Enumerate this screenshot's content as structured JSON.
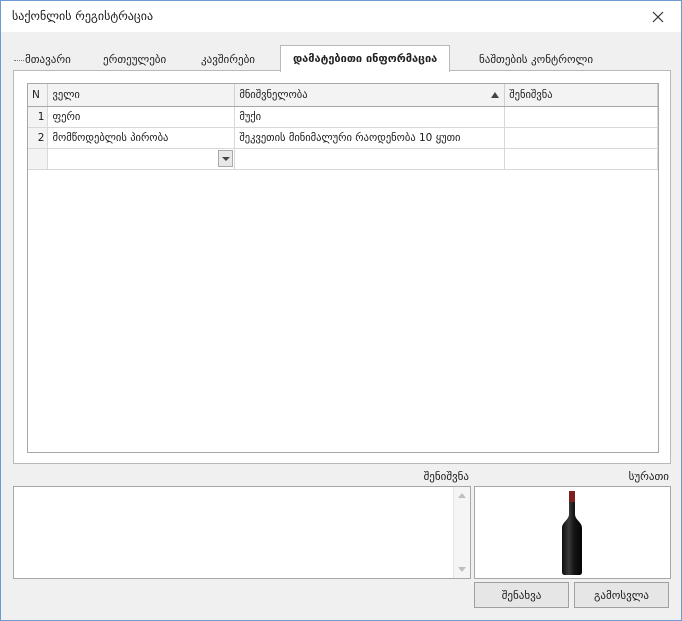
{
  "window": {
    "title": "საქონლის რეგისტრაცია"
  },
  "tabs": [
    {
      "label": "მთავარი"
    },
    {
      "label": "ერთეულები"
    },
    {
      "label": "კავშირები"
    },
    {
      "label": "დამატებითი ინფორმაცია",
      "active": true
    },
    {
      "label": "ნაშთების კონტროლი"
    }
  ],
  "grid": {
    "columns": [
      "N",
      "ველი",
      "მნიშვნელობა",
      "შენიშვნა"
    ],
    "sorted_column": "მნიშვნელობა",
    "sort_direction": "ascending",
    "rows": [
      {
        "n": "1",
        "field": "ფერი",
        "value": "მუქი",
        "note": ""
      },
      {
        "n": "2",
        "field": "მომწოდებლის პირობა",
        "value": "შეკვეთის მინიმალური რაოდენობა 10 ყუთი",
        "note": ""
      }
    ],
    "new_row": {
      "field": "",
      "value": "",
      "note": ""
    }
  },
  "note_section": {
    "label": "შენიშვნა",
    "value": ""
  },
  "image_section": {
    "label": "სურათი",
    "image_icon": "wine-bottle-icon"
  },
  "buttons": {
    "save": "შენახვა",
    "exit": "გამოსვლა"
  },
  "colors": {
    "window_border": "#6d9bd1",
    "background": "#f0f0f0",
    "bottle_glass": "#1a1a1a",
    "bottle_cap": "#7b1f1f"
  }
}
